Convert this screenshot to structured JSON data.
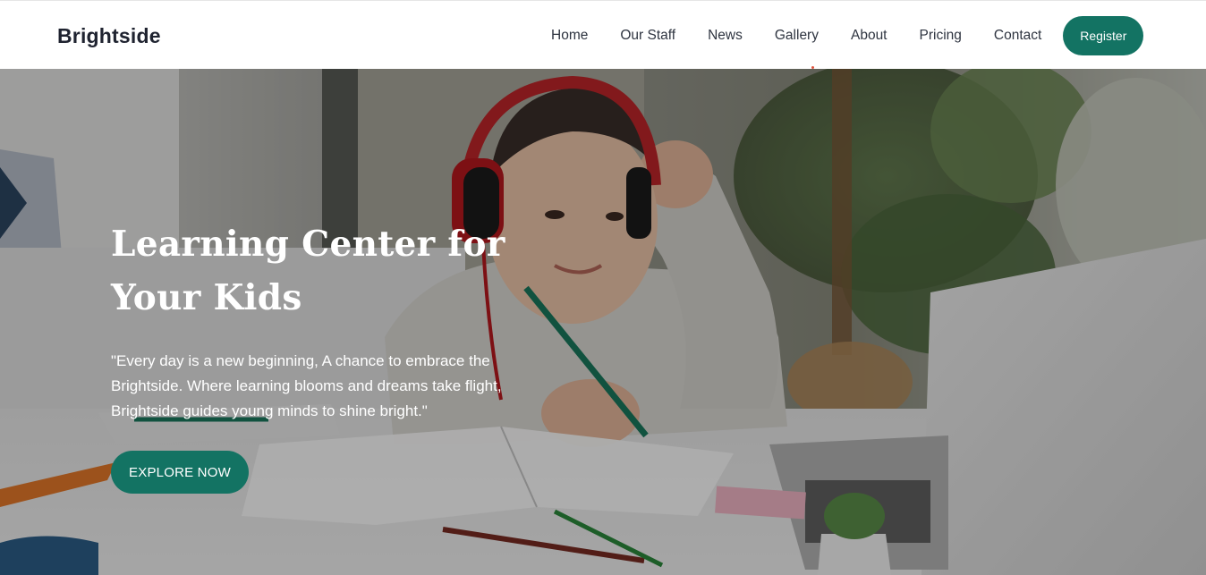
{
  "header": {
    "brand": "Brightside",
    "nav": [
      "Home",
      "Our Staff",
      "News",
      "Gallery",
      "About",
      "Pricing",
      "Contact"
    ],
    "register_label": "Register"
  },
  "hero": {
    "title_line1": "Learning Center for",
    "title_line2": "Your Kids",
    "quote": "\"Every day is a new beginning, A chance to embrace the Brightside. Where learning blooms and dreams take flight, Brightside guides young minds to shine bright.\"",
    "cta_label": "EXPLORE NOW",
    "image_subject": "boy-with-headphones-studying"
  },
  "colors": {
    "accent": "#137363",
    "header_bg": "#ffffff",
    "brand_text": "#1f2330",
    "nav_text": "#2e3440"
  }
}
